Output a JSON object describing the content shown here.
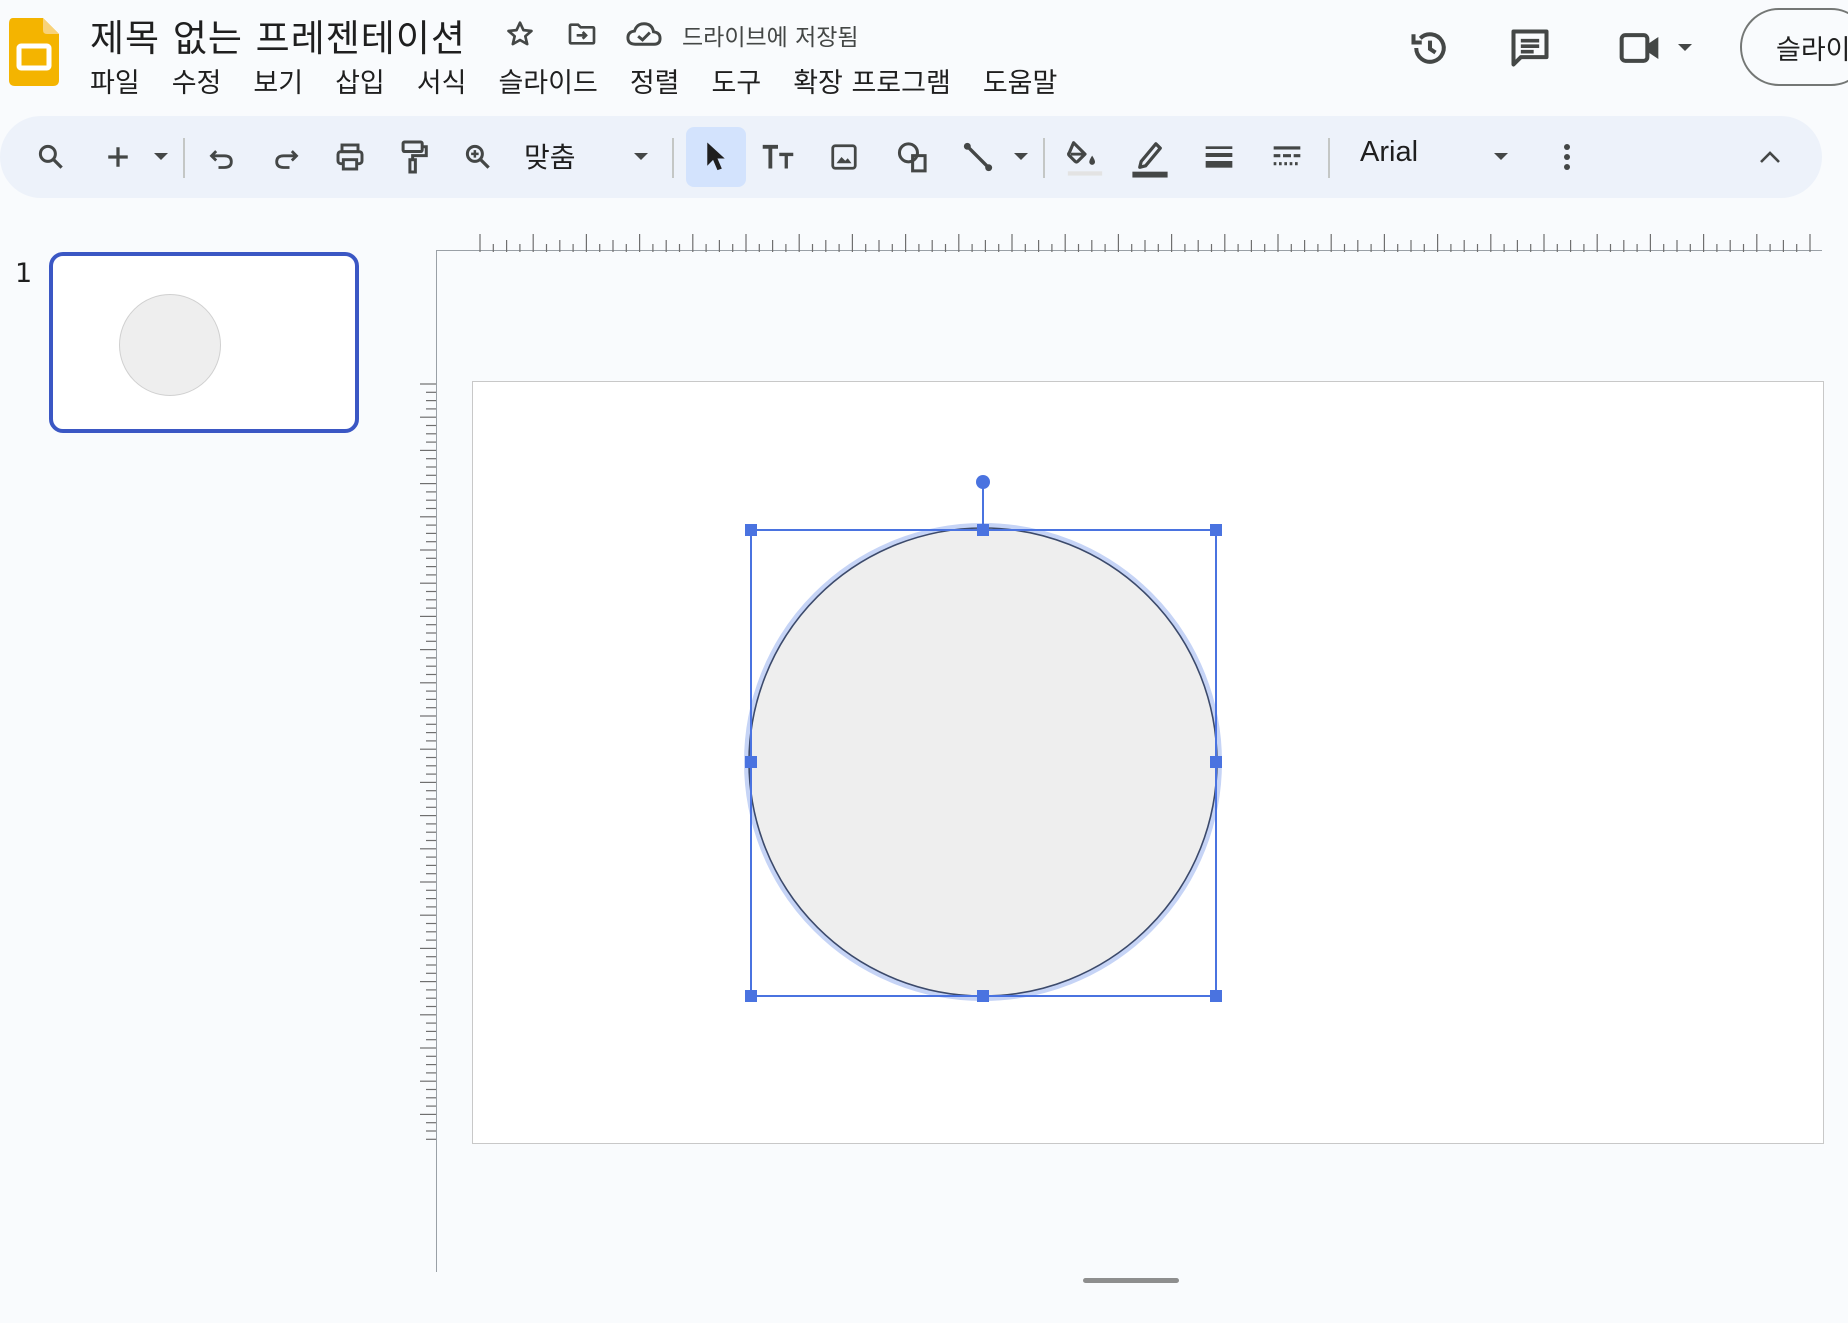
{
  "document": {
    "title": "제목 없는 프레젠테이션",
    "save_status": "드라이브에 저장됨"
  },
  "menu": [
    {
      "label": "파일"
    },
    {
      "label": "수정"
    },
    {
      "label": "보기"
    },
    {
      "label": "삽입"
    },
    {
      "label": "서식"
    },
    {
      "label": "슬라이드"
    },
    {
      "label": "정렬"
    },
    {
      "label": "도구"
    },
    {
      "label": "확장 프로그램"
    },
    {
      "label": "도움말"
    }
  ],
  "header_right": {
    "share_label": "슬라이드쇼",
    "icons": [
      "version-history-icon",
      "comments-icon",
      "meet-camera-icon",
      "dropdown-arrow-icon"
    ]
  },
  "toolbar": {
    "zoom_value": "맞춤",
    "font_name": "Arial",
    "icons": [
      "search-icon",
      "new-slide-plus-icon",
      "undo-icon",
      "redo-icon",
      "print-icon",
      "paint-format-icon",
      "zoom-icon",
      "select-cursor-icon",
      "text-box-icon",
      "image-icon",
      "shape-icon",
      "line-icon",
      "fill-color-icon",
      "border-color-icon",
      "border-weight-icon",
      "border-dash-icon",
      "more-vert-icon",
      "collapse-toolbar-icon"
    ]
  },
  "filmstrip": {
    "slides": [
      {
        "number": "1"
      }
    ]
  },
  "colors": {
    "accent_blue": "#4a73e0",
    "selection_border": "#3b57c4",
    "shape_fill": "#eeeeee",
    "toolbar_bg": "#edf2fa",
    "logo_yellow": "#f4b400"
  }
}
